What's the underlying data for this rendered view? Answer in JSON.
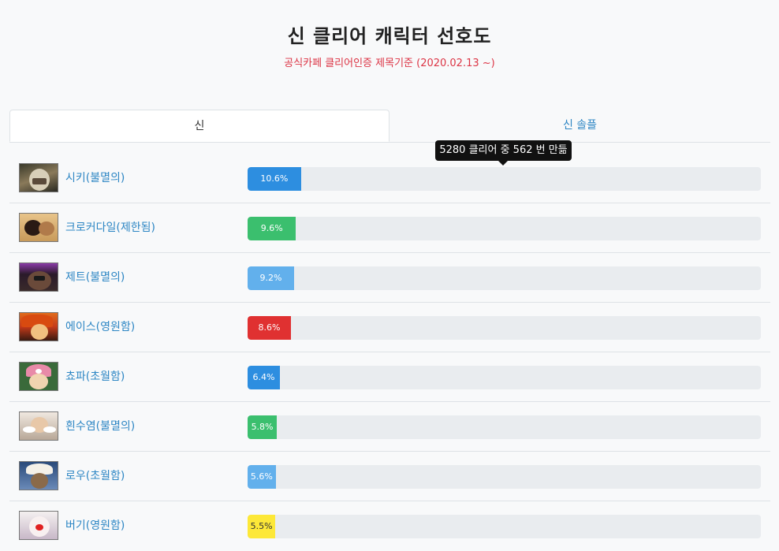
{
  "header": {
    "title": "신 클리어 캐릭터 선호도",
    "subtitle": "공식카페 클리어인증 제목기준 (2020.02.13 ~)"
  },
  "tabs": [
    {
      "label": "신",
      "active": true
    },
    {
      "label": "신 솔플",
      "active": false
    }
  ],
  "tooltip": {
    "text": "5280 클리어 중 562 번 만듦"
  },
  "characters": [
    {
      "name": "시키(불멸의)",
      "percent_label": "10.6%",
      "percent": 10.6,
      "bar_color": "#2d8ee0",
      "label_color": "#ffffff",
      "thumb_icon": "shiki-portrait"
    },
    {
      "name": "크로커다일(제한됨)",
      "percent_label": "9.6%",
      "percent": 9.6,
      "bar_color": "#3bbf6e",
      "label_color": "#ffffff",
      "thumb_icon": "crocodile-portrait"
    },
    {
      "name": "제트(불멸의)",
      "percent_label": "9.2%",
      "percent": 9.2,
      "bar_color": "#62b0ec",
      "label_color": "#ffffff",
      "thumb_icon": "zephyr-portrait"
    },
    {
      "name": "에이스(영원함)",
      "percent_label": "8.6%",
      "percent": 8.6,
      "bar_color": "#e03131",
      "label_color": "#ffffff",
      "thumb_icon": "ace-portrait"
    },
    {
      "name": "쵸파(초월함)",
      "percent_label": "6.4%",
      "percent": 6.4,
      "bar_color": "#2d8ee0",
      "label_color": "#ffffff",
      "thumb_icon": "chopper-portrait"
    },
    {
      "name": "흰수염(불멸의)",
      "percent_label": "5.8%",
      "percent": 5.8,
      "bar_color": "#3bbf6e",
      "label_color": "#ffffff",
      "thumb_icon": "whitebeard-portrait"
    },
    {
      "name": "로우(초월함)",
      "percent_label": "5.6%",
      "percent": 5.6,
      "bar_color": "#62b0ec",
      "label_color": "#ffffff",
      "thumb_icon": "law-portrait"
    },
    {
      "name": "버기(영원함)",
      "percent_label": "5.5%",
      "percent": 5.5,
      "bar_color": "#fde838",
      "label_color": "#333333",
      "thumb_icon": "buggy-portrait"
    }
  ]
}
